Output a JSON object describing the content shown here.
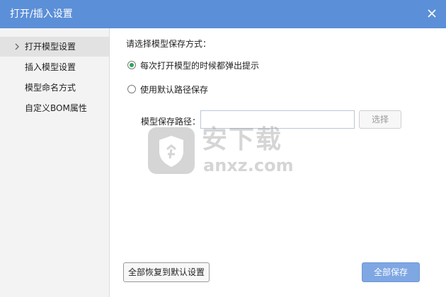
{
  "window": {
    "title": "打开/插入设置",
    "accent_color": "#5b8fd8"
  },
  "sidebar": {
    "items": [
      {
        "label": "打开模型设置",
        "active": true
      },
      {
        "label": "插入模型设置",
        "active": false
      },
      {
        "label": "模型命名方式",
        "active": false
      },
      {
        "label": "自定义BOM属性",
        "active": false
      }
    ]
  },
  "main": {
    "save_method_label": "请选择模型保存方式：",
    "options": [
      {
        "label": "每次打开模型的时候都弹出提示",
        "selected": true
      },
      {
        "label": "使用默认路径保存",
        "selected": false
      }
    ],
    "path_label": "模型保存路径：",
    "path_value": "",
    "select_button": "选择",
    "restore_button": "全部恢复到默认设置",
    "save_all_button": "全部保存"
  },
  "watermark": {
    "cn": "安下载",
    "domain": "anxz.com",
    "icon": "shield-icon"
  }
}
